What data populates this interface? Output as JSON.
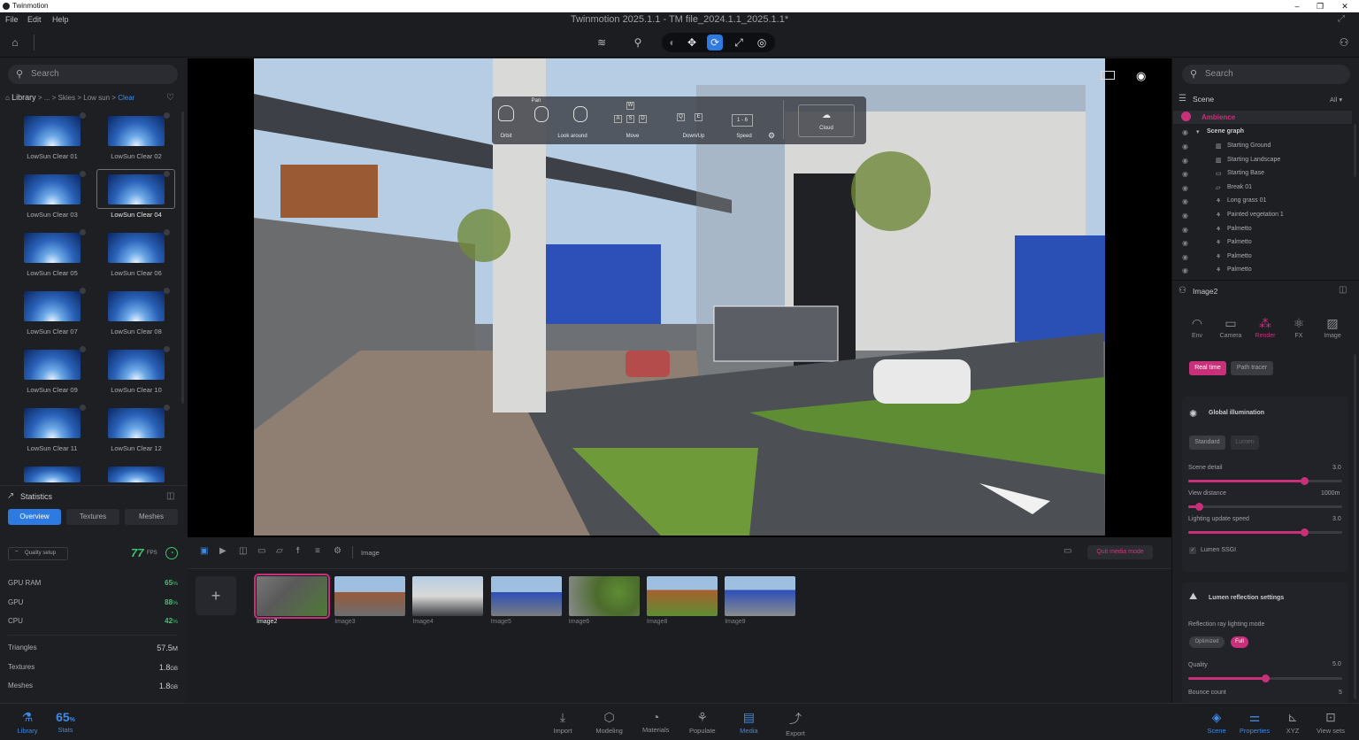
{
  "app": {
    "name": "Twinmotion",
    "window_title": "Twinmotion 2025.1.1 - TM file_2024.1.1_2025.1.1*"
  },
  "menu": [
    "File",
    "Edit",
    "Help"
  ],
  "left": {
    "search_placeholder": "Search",
    "breadcrumb": [
      "Library",
      ">",
      "...",
      ">",
      "Skies",
      ">",
      "Low sun",
      ">",
      "Clear"
    ],
    "thumbs": [
      "LowSun Clear 01",
      "LowSun Clear 02",
      "LowSun Clear 03",
      "LowSun Clear 04",
      "LowSun Clear 05",
      "LowSun Clear 06",
      "LowSun Clear 07",
      "LowSun Clear 08",
      "LowSun Clear 09",
      "LowSun Clear 10",
      "LowSun Clear 11",
      "LowSun Clear 12"
    ],
    "selected_thumb": "LowSun Clear 04"
  },
  "stats": {
    "title": "Statistics",
    "tabs": [
      "Overview",
      "Textures",
      "Meshes"
    ],
    "quality": "Quality setup",
    "fps": "77",
    "fps_unit": "FPS",
    "gpu_ram": {
      "label": "GPU RAM",
      "value": "65",
      "unit": "%"
    },
    "gpu": {
      "label": "GPU",
      "value": "88",
      "unit": "%"
    },
    "cpu": {
      "label": "CPU",
      "value": "42",
      "unit": "%"
    },
    "triangles": {
      "label": "Triangles",
      "value": "57.5",
      "unit": "M"
    },
    "textures": {
      "label": "Textures",
      "value": "1.8",
      "unit": "GB"
    },
    "meshes": {
      "label": "Meshes",
      "value": "1.8",
      "unit": "GB"
    }
  },
  "navhelp": {
    "orbit": "Orbit",
    "pan": "Pan",
    "look": "Look around",
    "move": "Move",
    "downup": "Down/Up",
    "speed": "Speed",
    "speed_keys": "1 - 6",
    "cloud": "Cloud",
    "w": "W",
    "a": "A",
    "s": "S",
    "d": "D",
    "q": "Q",
    "e": "E"
  },
  "media": {
    "section": "Image",
    "quit": "Quit media mode",
    "add": "+",
    "items": [
      "Image2",
      "Image3",
      "Image4",
      "Image5",
      "Image6",
      "Image8",
      "Image9"
    ],
    "selected": "Image2"
  },
  "right": {
    "search_placeholder": "Search",
    "scene_title": "Scene",
    "filter": "All",
    "ambience": "Ambience",
    "scene_graph": "Scene graph",
    "items": [
      "Starting Ground",
      "Starting Landscape",
      "Starting Base",
      "Break 01",
      "Long grass 01",
      "Painted vegetation 1",
      "Palmetto",
      "Palmetto",
      "Palmetto",
      "Palmetto"
    ],
    "props_title": "Image2",
    "tabs": [
      "Env",
      "Camera",
      "Render",
      "FX",
      "Image"
    ],
    "active_tab": "Render",
    "mode_realtime": "Real time",
    "mode_path": "Path tracer",
    "gi": "Global illumination",
    "gi_standard": "Standard",
    "gi_lumen": "Lumen",
    "scene_detail": {
      "label": "Scene detail",
      "value": "3.0",
      "level": 0.75
    },
    "view_distance": {
      "label": "View distance",
      "value": "1000m",
      "level": 0.07
    },
    "lighting_speed": {
      "label": "Lighting update speed",
      "value": "3.0",
      "level": 0.75
    },
    "ssgi": "Lumen SSGI",
    "reflection": "Lumen reflection settings",
    "ray_mode": "Reflection ray lighting mode",
    "ray_opt": "Optimized",
    "ray_full": "Full",
    "quality": {
      "label": "Quality",
      "value": "5.0",
      "level": 0.5
    },
    "bounce": {
      "label": "Bounce count",
      "value": "5"
    }
  },
  "bottom": {
    "left": [
      {
        "label": "Library",
        "icon": "library-icon"
      },
      {
        "label": "Stats",
        "value": "65",
        "unit": "%"
      }
    ],
    "center": [
      "Import",
      "Modeling",
      "Materials",
      "Populate",
      "Media",
      "Export"
    ],
    "active_center": "Media",
    "right": [
      "Scene",
      "Properties",
      "XYZ",
      "View sets"
    ]
  },
  "colors": {
    "accent": "#c8317a",
    "blue": "#2d7be0",
    "green": "#3ec46d"
  }
}
